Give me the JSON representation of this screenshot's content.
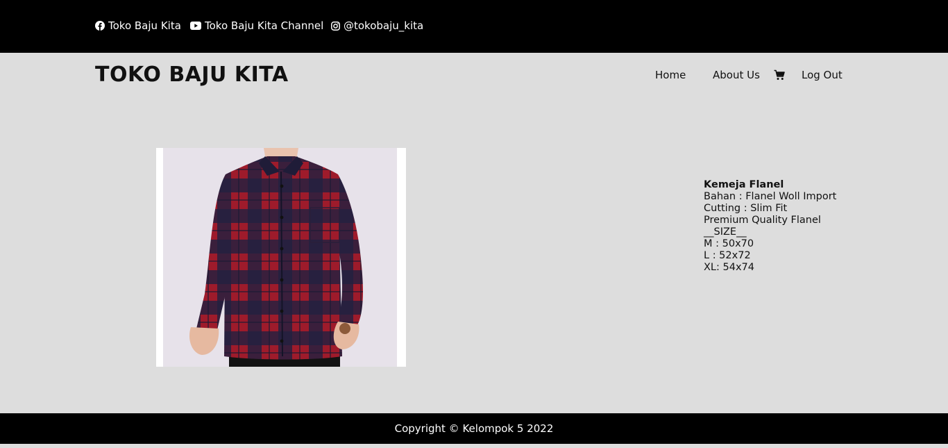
{
  "topbar": {
    "facebook": {
      "icon": "facebook-icon",
      "label": "Toko Baju Kita"
    },
    "youtube": {
      "icon": "youtube-icon",
      "label": "Toko Baju Kita Channel"
    },
    "instagram": {
      "icon": "instagram-icon",
      "label": "@tokobaju_kita"
    }
  },
  "header": {
    "brand": "TOKO BAJU KITA",
    "nav": {
      "home": "Home",
      "about": "About Us",
      "cart_icon": "cart-icon",
      "logout": "Log Out"
    }
  },
  "product": {
    "image": "plaid-flannel-shirt",
    "name": "Kemeja Flanel",
    "lines": [
      "Bahan : Flanel Woll Import",
      "Cutting : Slim Fit",
      "Premium Quality Flanel",
      "__SIZE__",
      "M : 50x70",
      "L : 52x72",
      "XL: 54x74"
    ]
  },
  "footer": {
    "copyright": "Copyright © Kelompok 5 2022"
  },
  "colors": {
    "topbar_bg": "#000000",
    "page_bg": "#dddddd",
    "footer_bg": "#000000",
    "shirt_red": "#9e1b2b",
    "shirt_navy": "#1c1c3a"
  }
}
